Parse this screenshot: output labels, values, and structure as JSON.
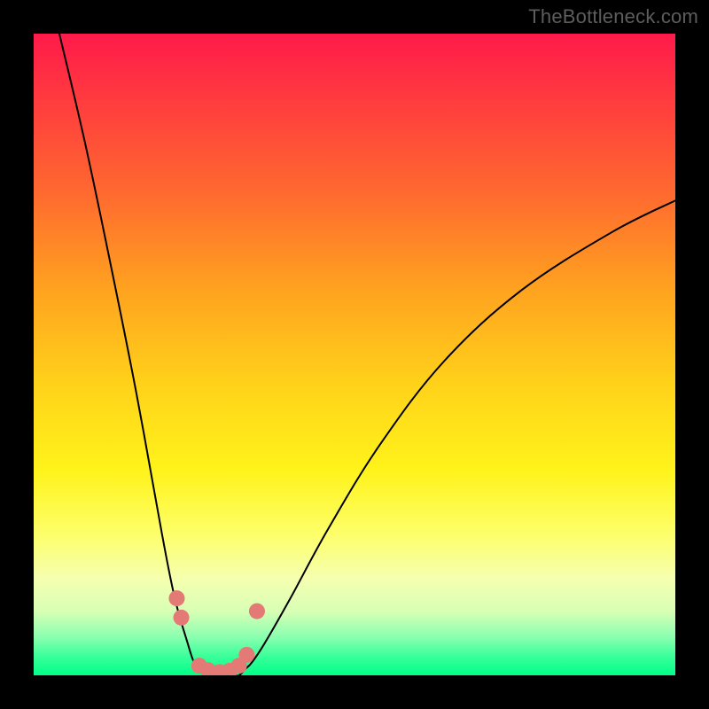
{
  "watermark": "TheBottleneck.com",
  "chart_data": {
    "type": "line",
    "title": "",
    "xlabel": "",
    "ylabel": "",
    "xlim": [
      0,
      100
    ],
    "ylim": [
      0,
      100
    ],
    "grid": false,
    "legend": false,
    "series": [
      {
        "name": "left-curve",
        "x": [
          4,
          8,
          12,
          16,
          20,
          22,
          24,
          25,
          26,
          27,
          28
        ],
        "values": [
          100,
          83,
          64,
          44,
          22,
          12,
          5,
          2,
          1,
          0,
          0
        ]
      },
      {
        "name": "right-curve",
        "x": [
          31,
          32,
          33,
          34,
          36,
          40,
          46,
          54,
          64,
          76,
          90,
          100
        ],
        "values": [
          0,
          0,
          1,
          2,
          5,
          12,
          23,
          36,
          49,
          60,
          69,
          74
        ]
      }
    ],
    "markers": [
      {
        "name": "left-dot-upper",
        "x": 22.3,
        "y": 12
      },
      {
        "name": "left-dot-lower",
        "x": 23.0,
        "y": 9
      },
      {
        "name": "trough-dot-1",
        "x": 25.8,
        "y": 1.5
      },
      {
        "name": "trough-dot-2",
        "x": 27.2,
        "y": 0.8
      },
      {
        "name": "trough-dot-3",
        "x": 29.0,
        "y": 0.5
      },
      {
        "name": "trough-dot-4",
        "x": 30.5,
        "y": 0.7
      },
      {
        "name": "trough-dot-5",
        "x": 32.0,
        "y": 1.5
      },
      {
        "name": "trough-dot-6",
        "x": 33.2,
        "y": 3.2
      },
      {
        "name": "right-dot",
        "x": 34.8,
        "y": 10
      }
    ],
    "gradient_stops": [
      {
        "offset": 0,
        "color": "#ff1a4a"
      },
      {
        "offset": 55,
        "color": "#ffd31a"
      },
      {
        "offset": 85,
        "color": "#f5ffb0"
      },
      {
        "offset": 100,
        "color": "#00ff88"
      }
    ]
  }
}
